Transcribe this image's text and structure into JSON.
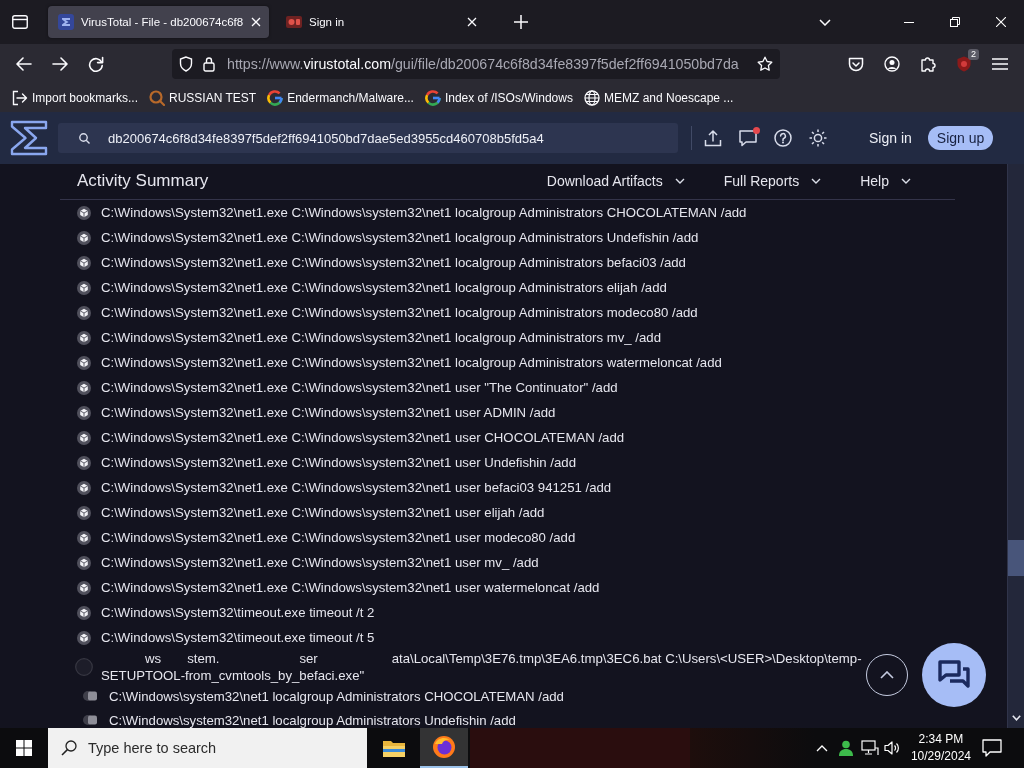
{
  "browser": {
    "tabs": [
      {
        "kind": "virustotal",
        "title": "VirusTotal - File - db200674c6f8",
        "selected": true
      },
      {
        "kind": "site",
        "title": "Sign in",
        "selected": false
      }
    ],
    "address_bar": {
      "scheme": "https://www.",
      "domain": "virustotal.com",
      "path": "/gui/file/db200674c6f8d34fe8397f5def2ff6941050bd7da"
    },
    "extension_badge": "2",
    "bookmarks": [
      {
        "kind": "import",
        "label": "Import bookmarks..."
      },
      {
        "kind": "site",
        "label": "RUSSIAN TEST"
      },
      {
        "kind": "google",
        "label": "Endermanch/Malware..."
      },
      {
        "kind": "google",
        "label": "Index of /ISOs/Windows"
      },
      {
        "kind": "web",
        "label": "MEMZ and Noescape ..."
      }
    ]
  },
  "site_header": {
    "search": {
      "value": "db200674c6f8d34fe8397f5def2ff6941050bd7dae5ed3955cd460708b5fd5a4"
    },
    "notifications": true,
    "sign_in": "Sign in",
    "sign_up": "Sign up"
  },
  "activity_summary": {
    "title": "Activity Summary",
    "menus": [
      "Download Artifacts",
      "Full Reports",
      "Help"
    ],
    "processes": [
      {
        "kind": "process",
        "command": "C:\\Windows\\System32\\net1.exe C:\\Windows\\system32\\net1 localgroup Administrators CHOCOLATEMAN /add"
      },
      {
        "kind": "process",
        "command": "C:\\Windows\\System32\\net1.exe C:\\Windows\\system32\\net1 localgroup Administrators Undefishin /add"
      },
      {
        "kind": "process",
        "command": "C:\\Windows\\System32\\net1.exe C:\\Windows\\system32\\net1 localgroup Administrators befaci03 /add"
      },
      {
        "kind": "process",
        "command": "C:\\Windows\\System32\\net1.exe C:\\Windows\\system32\\net1 localgroup Administrators elijah /add"
      },
      {
        "kind": "process",
        "command": "C:\\Windows\\System32\\net1.exe C:\\Windows\\system32\\net1 localgroup Administrators modeco80 /add"
      },
      {
        "kind": "process",
        "command": "C:\\Windows\\System32\\net1.exe C:\\Windows\\system32\\net1 localgroup Administrators mv_ /add"
      },
      {
        "kind": "process",
        "command": "C:\\Windows\\System32\\net1.exe C:\\Windows\\system32\\net1 localgroup Administrators watermeloncat /add"
      },
      {
        "kind": "process",
        "command": "C:\\Windows\\System32\\net1.exe C:\\Windows\\system32\\net1 user \"The Continuator\" /add"
      },
      {
        "kind": "process",
        "command": "C:\\Windows\\System32\\net1.exe C:\\Windows\\system32\\net1 user ADMIN /add"
      },
      {
        "kind": "process",
        "command": "C:\\Windows\\System32\\net1.exe C:\\Windows\\system32\\net1 user CHOCOLATEMAN /add"
      },
      {
        "kind": "process",
        "command": "C:\\Windows\\System32\\net1.exe C:\\Windows\\system32\\net1 user Undefishin /add"
      },
      {
        "kind": "process",
        "command": "C:\\Windows\\System32\\net1.exe C:\\Windows\\system32\\net1 user befaci03 941251 /add"
      },
      {
        "kind": "process",
        "command": "C:\\Windows\\System32\\net1.exe C:\\Windows\\system32\\net1 user elijah /add"
      },
      {
        "kind": "process",
        "command": "C:\\Windows\\System32\\net1.exe C:\\Windows\\system32\\net1 user modeco80 /add"
      },
      {
        "kind": "process",
        "command": "C:\\Windows\\System32\\net1.exe C:\\Windows\\system32\\net1 user mv_ /add"
      },
      {
        "kind": "process",
        "command": "C:\\Windows\\System32\\net1.exe C:\\Windows\\system32\\net1 user watermeloncat /add"
      },
      {
        "kind": "process",
        "command": "C:\\Windows\\System32\\timeout.exe timeout /t 2"
      },
      {
        "kind": "process",
        "command": "C:\\Windows\\System32\\timeout.exe timeout /t 5"
      },
      {
        "kind": "script",
        "fragments": [
          "ws",
          "stem.",
          "ser",
          "ata\\Local\\Temp\\3E76.tmp\\3EA6.tmp\\3EC6.bat C:\\Users\\<USER>\\Desktop\\temp-"
        ],
        "continuation": "SETUPTOOL-from_cvmtools_by_befaci.exe\"",
        "children": [
          {
            "kind": "command",
            "command": "C:\\Windows\\system32\\net1 localgroup Administrators CHOCOLATEMAN /add"
          },
          {
            "kind": "command",
            "command": "C:\\Windows\\system32\\net1 localgroup Administrators Undefishin /add"
          }
        ]
      }
    ]
  },
  "taskbar": {
    "search": {
      "placeholder": "Type here to search"
    },
    "apps": [
      {
        "kind": "files",
        "selected": false
      },
      {
        "kind": "firefox",
        "selected": true
      }
    ],
    "time": "2:34 PM",
    "date": "10/29/2024"
  }
}
